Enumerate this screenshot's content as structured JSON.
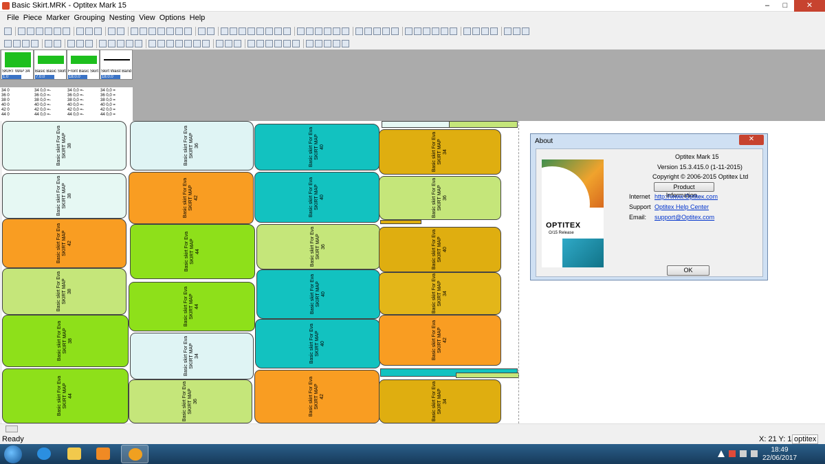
{
  "window": {
    "title": "Basic Skirt.MRK - Optitex Mark 15",
    "minimize": "–",
    "maximize": "□",
    "close": "✕"
  },
  "menu": [
    "File",
    "Piece",
    "Marker",
    "Grouping",
    "Nesting",
    "View",
    "Options",
    "Help"
  ],
  "piece_bar": {
    "cards": [
      {
        "name": "SKIRT MAP 34",
        "qty": "1.0"
      },
      {
        "name": "Basic Basic Skirt",
        "qty": "7.0.0"
      },
      {
        "name": "Front Basic Skirt",
        "qty": "18.0.0"
      },
      {
        "name": "Skirt Waist Band",
        "qty": "18.0.0"
      }
    ],
    "size_columns": [
      [
        "34   0",
        "36   0",
        "38   0",
        "40   0",
        "42   0",
        "44   0"
      ],
      [
        "34  0,0 =-",
        "36  0,0 =-",
        "38  0,0 =-",
        "40  0,0 =-",
        "42  0,0 =-",
        "44  0,0 =-"
      ],
      [
        "34  0,0 =-",
        "36  0,0 =-",
        "38  0,0 =-",
        "40  0,0 =-",
        "42  0,0 =-",
        "44  0,0 =-"
      ],
      [
        "34  0,0 =",
        "36  0,0 =",
        "38  0,0 =",
        "40  0,0 =",
        "42  0,0 =",
        "44  0,0 ="
      ]
    ]
  },
  "marker": {
    "piece_label_line1": "Basic skirt For Eva",
    "piece_label_line2": "SKIRT MAP",
    "pieces": [
      {
        "size": "38"
      },
      {
        "size": "36"
      },
      {
        "size": "40"
      },
      {
        "size": "34"
      },
      {
        "size": "38"
      },
      {
        "size": "42"
      },
      {
        "size": "40"
      },
      {
        "size": "36"
      },
      {
        "size": "42"
      },
      {
        "size": "44"
      },
      {
        "size": "36"
      },
      {
        "size": "40"
      },
      {
        "size": "38"
      },
      {
        "size": "44"
      },
      {
        "size": "40"
      },
      {
        "size": "34"
      },
      {
        "size": "38"
      },
      {
        "size": "34"
      },
      {
        "size": "40"
      },
      {
        "size": "42"
      },
      {
        "size": "44"
      },
      {
        "size": "36"
      },
      {
        "size": "42"
      },
      {
        "size": "34"
      }
    ]
  },
  "status": {
    "ready": "Ready",
    "coords": "X: 21  Y: 14",
    "user": "optitex"
  },
  "taskbar": {
    "time": "18:49",
    "date": "22/06/2017"
  },
  "about": {
    "title": "About",
    "close": "✕",
    "product": "Optitex Mark 15",
    "version": "Version 15.3.415.0 (1-11-2015)",
    "copyright": "Copyright © 2006-2015 Optitex Ltd",
    "product_info_button": "Product Information...",
    "internet_label": "Internet",
    "internet_value": "http://www.Optitex.com",
    "support_label": "Support",
    "support_value": "Optitex Help Center",
    "email_label": "Email:",
    "email_value": "support@Optitex.com",
    "logo_brand": "OPTITEX",
    "logo_release": "O/15 Release",
    "ok_button": "OK"
  }
}
